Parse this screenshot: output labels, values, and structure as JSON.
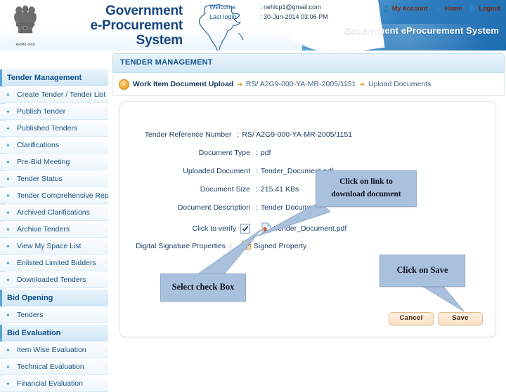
{
  "header": {
    "brand_lines": [
      "Government",
      "e-Procurement",
      "System"
    ],
    "emblem_motto": "सत्यमेव जयते",
    "welcome_label": "Welcome",
    "last_login_label": "Last login",
    "welcome_value": "nehlcp1@gmail.com",
    "last_login_value": "30-Jun-2014 03:06 PM",
    "colon": ":",
    "links": [
      {
        "label": "My Account",
        "icon": "user-icon"
      },
      {
        "label": "Home",
        "icon": "home-icon"
      },
      {
        "label": "Logout",
        "icon": "logout-icon"
      }
    ],
    "system_title": "Government eProcurement System",
    "brand_color": "#17457f",
    "banner_color": "#2f7fc0",
    "link_color": "#7d2b12"
  },
  "sidebar": {
    "groups": [
      {
        "title": "Tender Management",
        "items": [
          "Create Tender / Tender List",
          "Publish Tender",
          "Published Tenders",
          "Clarifications",
          "Pre-Bid Meeting",
          "Tender Status",
          "Tender Comprehensive Report",
          "Archived Clarifications",
          "Archive Tenders",
          "View My Space List",
          "Enlisted Limited Bidders",
          "Downloaded Tenders"
        ]
      },
      {
        "title": "Bid Opening",
        "items": [
          "Tenders"
        ]
      },
      {
        "title": "Bid Evaluation",
        "items": [
          "Item Wise Evaluation",
          "Technical Evaluation",
          "Financial Evaluation"
        ]
      }
    ]
  },
  "main": {
    "module_title": "TENDER MANAGEMENT",
    "breadcrumb": {
      "marker": "»",
      "crumb1": "Work Item Document Upload",
      "sep": "➜",
      "crumb2": "RS/ A2G9-000-YA-MR-2005/1151",
      "crumb3": "Upload Documents"
    },
    "details": [
      {
        "label": "Tender Reference Number",
        "value": "RS/ A2G9-000-YA-MR-2005/1151"
      },
      {
        "label": "Document Type",
        "value": "pdf"
      },
      {
        "label": "Uploaded Document",
        "value": "Tender_Document.pdf"
      },
      {
        "label": "Document Size",
        "value": "215.41  KBs"
      },
      {
        "label": "Document Description",
        "value": "Tender Document"
      }
    ],
    "colon": ":",
    "verify": {
      "label": "Click to verify",
      "checked": true,
      "file_link": "Tender_Document.pdf",
      "file_icon": "pdf-file-icon"
    },
    "signature": {
      "label": "Digital Signature Properties",
      "value": "Signed Property",
      "icon": "signature-icon"
    },
    "buttons": {
      "cancel": "Cancel",
      "save": "Save"
    }
  },
  "callouts": {
    "download": {
      "line1": "Click on link to",
      "line2": "download document"
    },
    "checkbox": {
      "line1": "Select check Box"
    },
    "save": {
      "line1": "Click on Save"
    },
    "fill_color": "#a9c1dd"
  }
}
